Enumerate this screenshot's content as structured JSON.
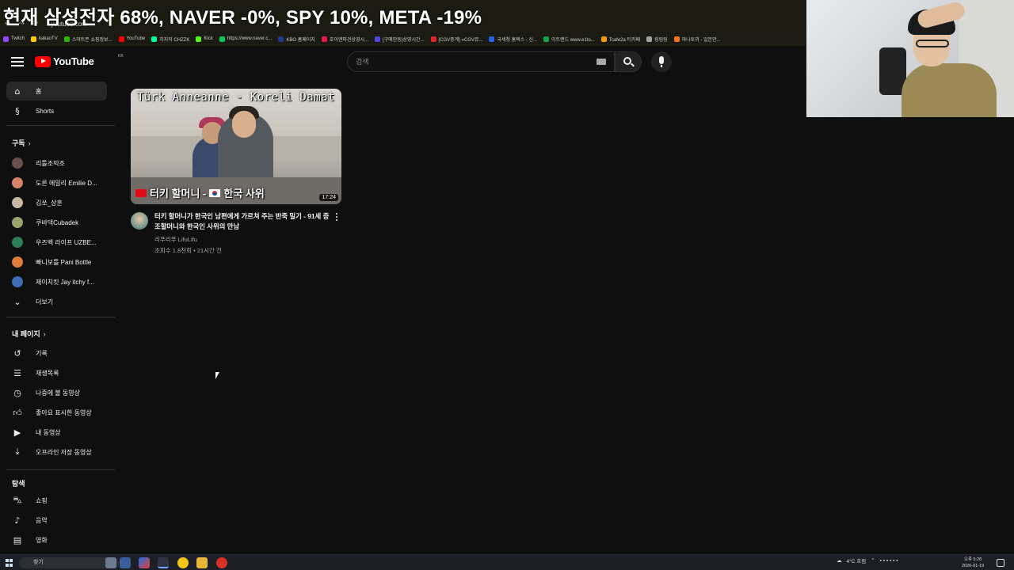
{
  "overlay": {
    "ticker": "현재 삼성전자 68%, NAVER -0%, SPY 10%, META -19%"
  },
  "browser": {
    "url": "youtube.com",
    "bookmarks": [
      {
        "label": "Twitch",
        "color": "#9146ff"
      },
      {
        "label": "kakaoTV",
        "color": "#ffcd00"
      },
      {
        "label": "스마트픈 쇼핑정보...",
        "color": "#2db400"
      },
      {
        "label": "YouTube",
        "color": "#ff0000"
      },
      {
        "label": "치지직 CHZZK",
        "color": "#00ffa3"
      },
      {
        "label": "Kick",
        "color": "#53fc18"
      },
      {
        "label": "https://www.naver.c...",
        "color": "#03c75a"
      },
      {
        "label": "KBO 홈페이지",
        "color": "#1e3a8a"
      },
      {
        "label": "호이엔파견상영시...",
        "color": "#e11d48"
      },
      {
        "label": "[구매안동]상영시간...",
        "color": "#4f46e5"
      },
      {
        "label": "[CGV중계] «CGV뮤...",
        "color": "#dc2626"
      },
      {
        "label": "국세청 홈택스 - 신...",
        "color": "#2563eb"
      },
      {
        "label": "이트랜드 www.e1to...",
        "color": "#16a34a"
      },
      {
        "label": "Tcafe2a 티카페",
        "color": "#f59e0b"
      },
      {
        "label": "링링링",
        "color": "#a3a3a3"
      },
      {
        "label": "마나토끼 - 일본만...",
        "color": "#f97316"
      }
    ]
  },
  "header": {
    "logo_text": "YouTube",
    "region": "KR",
    "search_placeholder": "검색"
  },
  "sidebar": {
    "main": [
      {
        "label": "홈",
        "icon": "home-icon"
      },
      {
        "label": "Shorts",
        "icon": "shorts-icon"
      }
    ],
    "subscriptions_title": "구독",
    "subscriptions": [
      {
        "label": "리틀조빅조",
        "color": "#6b4f4f"
      },
      {
        "label": "도른 에밀리 Emilie D...",
        "color": "#d4836a"
      },
      {
        "label": "김쏘_상훈",
        "color": "#c7b8a5"
      },
      {
        "label": "쿠바댁Cubadek",
        "color": "#9aa36b"
      },
      {
        "label": "우즈벡 라이프 UZBE...",
        "color": "#2e7d5b"
      },
      {
        "label": "빠니보틀 Pani Bottle",
        "color": "#e07b39"
      },
      {
        "label": "제이치킷 Jay itchy f...",
        "color": "#3f6db3"
      }
    ],
    "more_label": "더보기",
    "you_title": "내 페이지",
    "you": [
      {
        "label": "기록",
        "icon": "history-icon"
      },
      {
        "label": "재생목록",
        "icon": "playlist-icon"
      },
      {
        "label": "나중에 볼 동영상",
        "icon": "watch-later-icon"
      },
      {
        "label": "좋아요 표시한 동영상",
        "icon": "like-icon"
      },
      {
        "label": "내 동영상",
        "icon": "my-videos-icon"
      },
      {
        "label": "오프라인 저장 동영상",
        "icon": "download-icon"
      }
    ],
    "explore_title": "탐색",
    "explore": [
      {
        "label": "쇼핑",
        "icon": "shopping-icon"
      },
      {
        "label": "음악",
        "icon": "music-icon"
      },
      {
        "label": "영화",
        "icon": "movie-icon"
      }
    ]
  },
  "video": {
    "thumb_title": "Türk Anneanne - Koreli Damat",
    "thumb_caption_left": "터키 할머니 -",
    "thumb_caption_right": "한국 사위",
    "duration": "17:24",
    "title": "터키 할머니가 한국인 남편에게 가르쳐 주는 반죽 밀기 - 91세 증조할머니와 한국인 사위의 만남",
    "channel": "리푸리푸 LifuLifu",
    "meta": "조회수 1.8천회 • 21시간 전"
  },
  "taskbar": {
    "search_label": "찾기",
    "weather": "4°C 흐림",
    "time": "오후 5:28",
    "date": "2026-01-19"
  }
}
